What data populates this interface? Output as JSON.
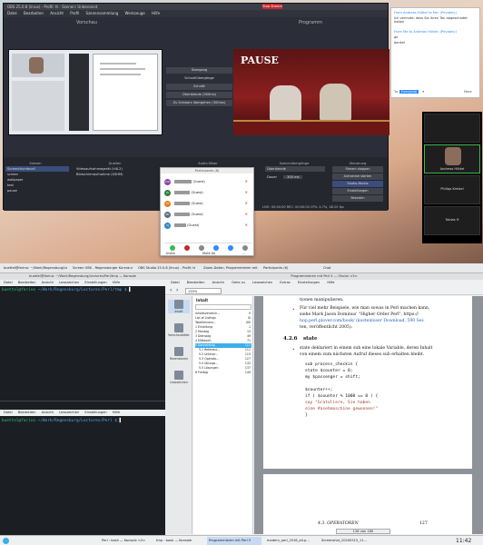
{
  "obs": {
    "title": "OBS 25.0.8 (linux) - Profil: tt - Szenen: Unbenannt",
    "live_badge": "Stop Stream",
    "menu": [
      "Datei",
      "Bearbeiten",
      "Ansicht",
      "Profil",
      "Szenensammlung",
      "Werkzeuge",
      "Hilfe"
    ],
    "preview_label": "Vorschau",
    "program_label": "Programm",
    "program_text": "PAUSE",
    "transition_buttons": [
      "Übergang",
      "Schnellübergänge",
      "Schnitt",
      "Überblende (300ms)",
      "Zu Schwarz übergehen (300ms)"
    ],
    "docks": {
      "scenes_header": "Szenen",
      "sources_header": "Quellen",
      "audio_header": "Audio-Mixer",
      "trans_header": "Szenenübergänge",
      "control_header": "Steuerung",
      "scenes": [
        "Screenthumbnail",
        "screen",
        "wallpaper",
        "test",
        "pause"
      ],
      "sources": [
        "Videoaufnahmegerät (V4L2)",
        "Bildschirmaufnahme (XSHM)"
      ],
      "transition": "Überblende",
      "duration_label": "Dauer",
      "duration": "300 ms",
      "controls": [
        "Stream stoppen",
        "Aufnahme starten",
        "Studio-Modus",
        "Einstellungen",
        "Beenden"
      ]
    },
    "status": "LIVE: 00:00:00   REC: 00:00:00   CPU: 4.7%, 48.20 fps"
  },
  "zoom_participants": {
    "title": "Participants (6)",
    "rows": [
      {
        "initials": "DS",
        "name": "(Guest)",
        "color": "#8e44ad"
      },
      {
        "initials": "JS",
        "name": "(Guest)",
        "color": "#2d7d3a"
      },
      {
        "initials": "TF",
        "name": "(Guest)",
        "color": "#e67e22"
      },
      {
        "initials": "PK",
        "name": "(Guest)",
        "color": "#5d6d7e"
      },
      {
        "initials": "VJ",
        "name": "(Guest)",
        "color": "#2e86c1"
      }
    ],
    "footer": [
      "Invite",
      "Mute All",
      "..."
    ]
  },
  "zoom_chat": {
    "lines": [
      "From Andreas Hüttel to Me: (Privately)",
      "Ich vermute, dass Sie Ihren Ton abgeschaltet haben",
      "From Me to Andreas Hüttel: (Privately)",
      "ge",
      "danke!"
    ],
    "to_label": "To:",
    "to_value": "Everyone",
    "more_label": "More"
  },
  "zoom_gallery": {
    "tiles": [
      "",
      "Andreas Hüttel",
      "Philipp Kreisel",
      "Tobias H"
    ]
  },
  "taskbar": [
    "buettel@farino: ~/Work/Regensburg/Lecture",
    "Screen OBS - Regensburger Kursraum",
    "OBS Studio 25.0.8 (linux) - Profil: tt",
    "Zoom-Daten, Programmieren mit Perl",
    "Participants (6)",
    "Chat"
  ],
  "konsole": {
    "title": "buettel@farino: ~/Work/Regensburg/Lectures/Perl/tmp — Konsole",
    "menu": [
      "Datei",
      "Bearbeiten",
      "Ansicht",
      "Lesezeichen",
      "Einstellungen",
      "Hilfe"
    ],
    "prompt1_user": "buettel@farino",
    "prompt1_path": "~/Work/Regensburg/Lectures/Perl/tmp $",
    "cursor": "▌",
    "menu2": [
      "Datei",
      "Bearbeiten",
      "Ansicht",
      "Lesezeichen",
      "Einstellungen",
      "Hilfe"
    ],
    "prompt2_user": "buettel@farino",
    "prompt2_path": "~/Work/Regensburg/Lectures/Perl $"
  },
  "okular": {
    "title": "Programmieren mit Perl 5 — Okular <3>",
    "menu": [
      "Datei",
      "Bearbeiten",
      "Ansicht",
      "Gehe zu",
      "Lesezeichen",
      "Extras",
      "Einstellungen",
      "Hilfe"
    ],
    "zoom": "135%",
    "side_icons": [
      "Inhalt",
      "Vorschaubilder",
      "Rezensionen",
      "Lesezeichen"
    ],
    "toc_header": "Inhalt",
    "toc": [
      [
        "Inhaltsverzeich...",
        "V"
      ],
      [
        "List of Listings",
        "XI"
      ],
      [
        "Tabellenverz...",
        "XIII"
      ],
      [
        "1 Einleitung",
        "1"
      ],
      [
        "2 Montag",
        "13"
      ],
      [
        "3 Dienstag",
        "49"
      ],
      [
        "4 Mittwoch",
        "71"
      ],
      [
        "5 Donnerstag",
        "111"
      ],
      [
        "5.1 Referenz...",
        "111"
      ],
      [
        "5.2 Unterpr...",
        "115"
      ],
      [
        "5.3 Operato...",
        "127"
      ],
      [
        "5.4 Übungs...",
        "132"
      ],
      [
        "5.5 Lösungen",
        "137"
      ],
      [
        "6 Freitag",
        "149"
      ]
    ],
    "para1": "tionen manipulieren.",
    "bullet1a": "Für viel mehr Beispiele, wie man sowas in Perl machen kann,",
    "bullet1b": "siehe Mark Jason Dominus' \"Higher Order Perl\", https://",
    "bullet1c": "hop.perl.plover.com/book/ (kostenloser Download, 590 Sei-",
    "bullet1d": "ten, veröffentlicht 2005).",
    "sec_num": "4.2.6",
    "sec_title": "state",
    "bullet2a": "state deklariert in einem sub eine lokale Variable, deren Inhalt",
    "bullet2b": "von einem zum nächsten Aufruf dieses sub erhalten bleibt.",
    "code": [
      "sub process_checkin {",
      "  state $counter = 0;",
      "  my $passenger = shift;",
      "",
      "  $counter++;",
      "  if ( $counter % 1000 == 0 ) {",
      "    say \"Gratuliere, Sie haben",
      "           eine #asehmaschine gewonnen!\"",
      "  }"
    ],
    "footer_section": "4.3.  OPERATOREN",
    "footer_page": "127",
    "page_current": "126",
    "page_sep": "von",
    "page_total": "180"
  },
  "bottom_panel": [
    "Perl : bash — Konsole <2>",
    "tmp : bash — Konsole",
    "Programmieren mit Perl 5",
    "modern_perl_2016_a4.p...",
    "Screenshot_20200515_11..."
  ],
  "clock": "11:42"
}
